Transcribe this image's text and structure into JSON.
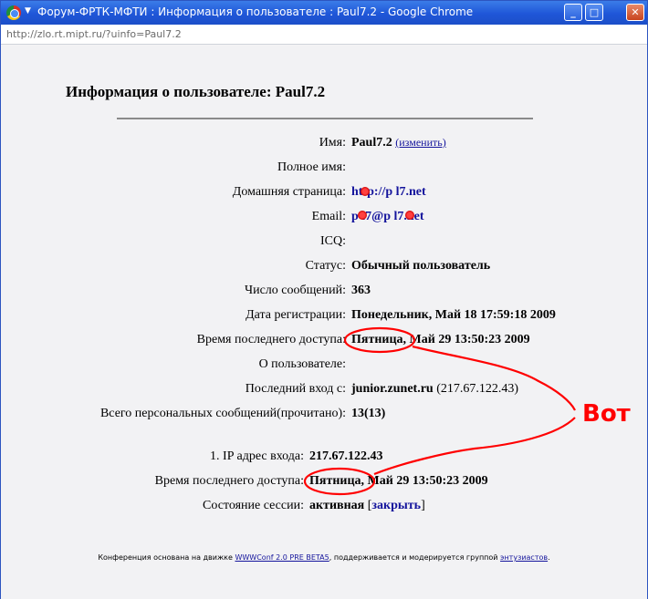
{
  "window": {
    "title": "Форум-ФРТК-МФТИ : Информация о пользователе : Paul7.2 - Google Chrome",
    "url": "http://zlo.rt.mipt.ru/?uinfo=Paul7.2",
    "minimize_symbol": "_",
    "maximize_symbol": "□",
    "close_symbol": "✕"
  },
  "page": {
    "title": "Информация о пользователе: Paul7.2"
  },
  "profile": {
    "name_label": "Имя:",
    "name_value": "Paul7.2",
    "change_link": "(изменить)",
    "fullname_label": "Полное имя:",
    "homepage_label": "Домашняя страница:",
    "homepage_value": "http://p   l7.net",
    "email_label": "Email:",
    "email_value": "p   l7@p   l7.net",
    "icq_label": "ICQ:",
    "status_label": "Статус:",
    "status_value": "Обычный пользователь",
    "posts_label": "Число сообщений:",
    "posts_value": "363",
    "regdate_label": "Дата регистрации:",
    "regdate_value": "Понедельник, Май 18 17:59:18 2009",
    "lastaccess_label": "Время последнего доступа:",
    "lastaccess_value": "Пятница, Май 29 13:50:23 2009",
    "about_label": "О пользователе:",
    "lastlogin_label": "Последний вход с:",
    "lastlogin_host": "junior.zunet.ru",
    "lastlogin_ip": "(217.67.122.43)",
    "pm_label": "Всего персональных сообщений(прочитано):",
    "pm_value": "13(13)"
  },
  "session": {
    "ip_label": "1. IP адрес входа:",
    "ip_value": "217.67.122.43",
    "lastaccess_label": "Время последнего доступа:",
    "lastaccess_value": "Пятница, Май 29 13:50:23 2009",
    "state_label": "Состояние сессии:",
    "state_value": "активная",
    "bracket_open": "[",
    "close_link": "закрыть",
    "bracket_close": "]"
  },
  "footer": {
    "text_before": "Конференция основана на движке ",
    "engine_link": "WWWConf 2.0 PRE BETA5",
    "text_middle": ", поддерживается и модерируется группой ",
    "group_link": "энтузиастов",
    "text_after": "."
  },
  "annotation": {
    "text": "Вот",
    "color": "#ff0000"
  }
}
